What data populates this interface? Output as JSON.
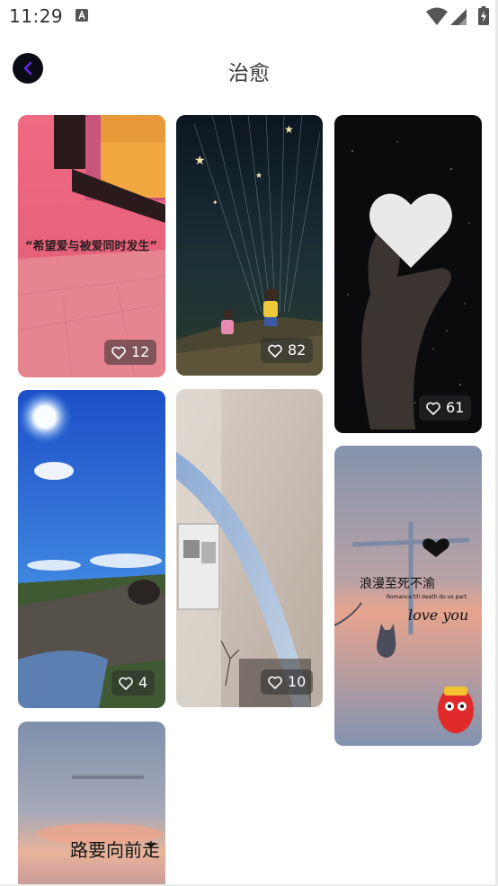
{
  "status_bar": {
    "time": "11:29"
  },
  "header": {
    "title": "治愈",
    "back_icon": "back-arrow-icon",
    "back_button_color": "#0b0b14",
    "accent_color": "#5a2be2"
  },
  "feed": {
    "items": [
      {
        "id": "card1",
        "likes": "12",
        "caption": "“希望爱与被爱同时发生”"
      },
      {
        "id": "card2",
        "likes": "82"
      },
      {
        "id": "card3",
        "likes": "61"
      },
      {
        "id": "card4",
        "likes": "4"
      },
      {
        "id": "card5",
        "likes": "10"
      },
      {
        "id": "card6",
        "likes": "",
        "caption": "浪漫至死不渝",
        "caption2": "Romance till death do us part",
        "caption3": "love you"
      },
      {
        "id": "card7",
        "likes": "",
        "caption": "路要向前走"
      }
    ]
  }
}
